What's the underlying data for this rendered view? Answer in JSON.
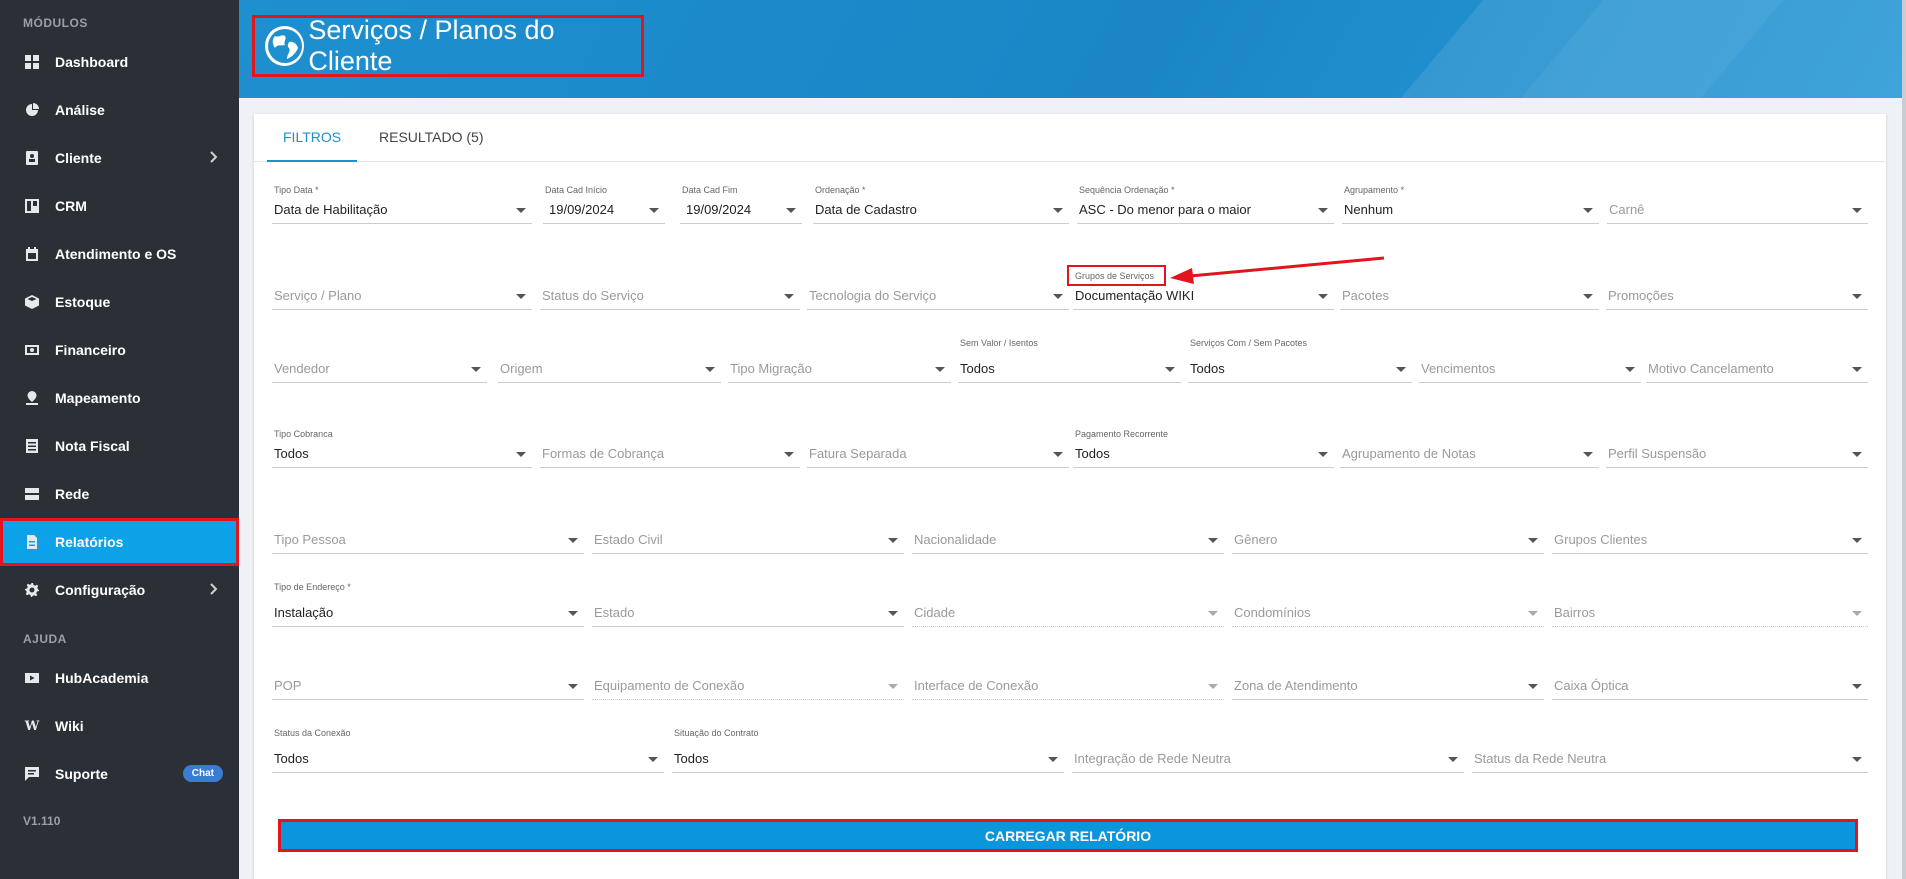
{
  "sidebar": {
    "modules_title": "MÓDULOS",
    "help_title": "AJUDA",
    "version": "V1.110",
    "items": [
      {
        "label": "Dashboard",
        "icon": "dashboard-icon"
      },
      {
        "label": "Análise",
        "icon": "pie-chart-icon"
      },
      {
        "label": "Cliente",
        "icon": "contact-book-icon"
      },
      {
        "label": "CRM",
        "icon": "crm-board-icon"
      },
      {
        "label": "Atendimento e OS",
        "icon": "calendar-icon"
      },
      {
        "label": "Estoque",
        "icon": "box-icon"
      },
      {
        "label": "Financeiro",
        "icon": "money-icon"
      },
      {
        "label": "Mapeamento",
        "icon": "map-pin-icon"
      },
      {
        "label": "Nota Fiscal",
        "icon": "invoice-icon"
      },
      {
        "label": "Rede",
        "icon": "server-icon"
      },
      {
        "label": "Relatórios",
        "icon": "report-icon"
      },
      {
        "label": "Configuração",
        "icon": "gear-icon"
      }
    ],
    "help_items": [
      {
        "label": "HubAcademia",
        "icon": "youtube-icon"
      },
      {
        "label": "Wiki",
        "icon": "wikipedia-icon"
      },
      {
        "label": "Suporte",
        "icon": "chat-icon",
        "badge": "Chat"
      }
    ]
  },
  "header": {
    "title": "Serviços / Planos do Cliente",
    "icon": "globe-icon"
  },
  "tabs": [
    {
      "label": "FILTROS",
      "active": true
    },
    {
      "label": "RESULTADO (5)",
      "active": false
    }
  ],
  "filters": {
    "row1": [
      {
        "label": "Tipo Data *",
        "value": "Data de Habilitação"
      },
      {
        "label": "Data Cad Início",
        "value": "19/09/2024"
      },
      {
        "label": "Data Cad Fim",
        "value": "19/09/2024"
      },
      {
        "label": "Ordenação *",
        "value": "Data de Cadastro"
      },
      {
        "label": "Sequência Ordenação *",
        "value": "ASC - Do menor para o maior"
      },
      {
        "label": "Agrupamento *",
        "value": "Nenhum"
      },
      {
        "placeholder": "Carnê"
      }
    ],
    "row2": [
      {
        "placeholder": "Serviço / Plano"
      },
      {
        "placeholder": "Status do Serviço"
      },
      {
        "placeholder": "Tecnologia do Serviço"
      },
      {
        "label": "Grupos de Serviços",
        "value": "Documentação WIKI"
      },
      {
        "placeholder": "Pacotes"
      },
      {
        "placeholder": "Promoções"
      }
    ],
    "row3": [
      {
        "placeholder": "Vendedor"
      },
      {
        "placeholder": "Origem"
      },
      {
        "placeholder": "Tipo Migração"
      },
      {
        "label": "Sem Valor / Isentos",
        "value": "Todos"
      },
      {
        "label": "Serviços Com / Sem Pacotes",
        "value": "Todos"
      },
      {
        "placeholder": "Vencimentos"
      },
      {
        "placeholder": "Motivo Cancelamento"
      }
    ],
    "row4": [
      {
        "label": "Tipo Cobranca",
        "value": "Todos"
      },
      {
        "placeholder": "Formas de Cobrança"
      },
      {
        "placeholder": "Fatura Separada"
      },
      {
        "label": "Pagamento Recorrente",
        "value": "Todos"
      },
      {
        "placeholder": "Agrupamento de Notas"
      },
      {
        "placeholder": "Perfil Suspensão"
      }
    ],
    "row5": [
      {
        "placeholder": "Tipo Pessoa"
      },
      {
        "placeholder": "Estado Civil"
      },
      {
        "placeholder": "Nacionalidade"
      },
      {
        "placeholder": "Gênero"
      },
      {
        "placeholder": "Grupos Clientes"
      }
    ],
    "row6": [
      {
        "label": "Tipo de Endereço *",
        "value": "Instalação"
      },
      {
        "placeholder": "Estado"
      },
      {
        "placeholder": "Cidade"
      },
      {
        "placeholder": "Condomínios"
      },
      {
        "placeholder": "Bairros"
      }
    ],
    "row7": [
      {
        "placeholder": "POP"
      },
      {
        "placeholder": "Equipamento de Conexão"
      },
      {
        "placeholder": "Interface de Conexão"
      },
      {
        "placeholder": "Zona de Atendimento"
      },
      {
        "placeholder": "Caixa Óptica"
      }
    ],
    "row8": [
      {
        "label": "Status da Conexão",
        "value": "Todos"
      },
      {
        "label": "Situação do Contrato",
        "value": "Todos"
      },
      {
        "placeholder": "Integração de Rede Neutra"
      },
      {
        "placeholder": "Status da Rede Neutra"
      }
    ]
  },
  "load_button": "CARREGAR RELATÓRIO",
  "colors": {
    "sidebar_bg": "#2b3036",
    "accent": "#1e8fcf",
    "button": "#0b96dc",
    "highlight": "#e0161c"
  }
}
